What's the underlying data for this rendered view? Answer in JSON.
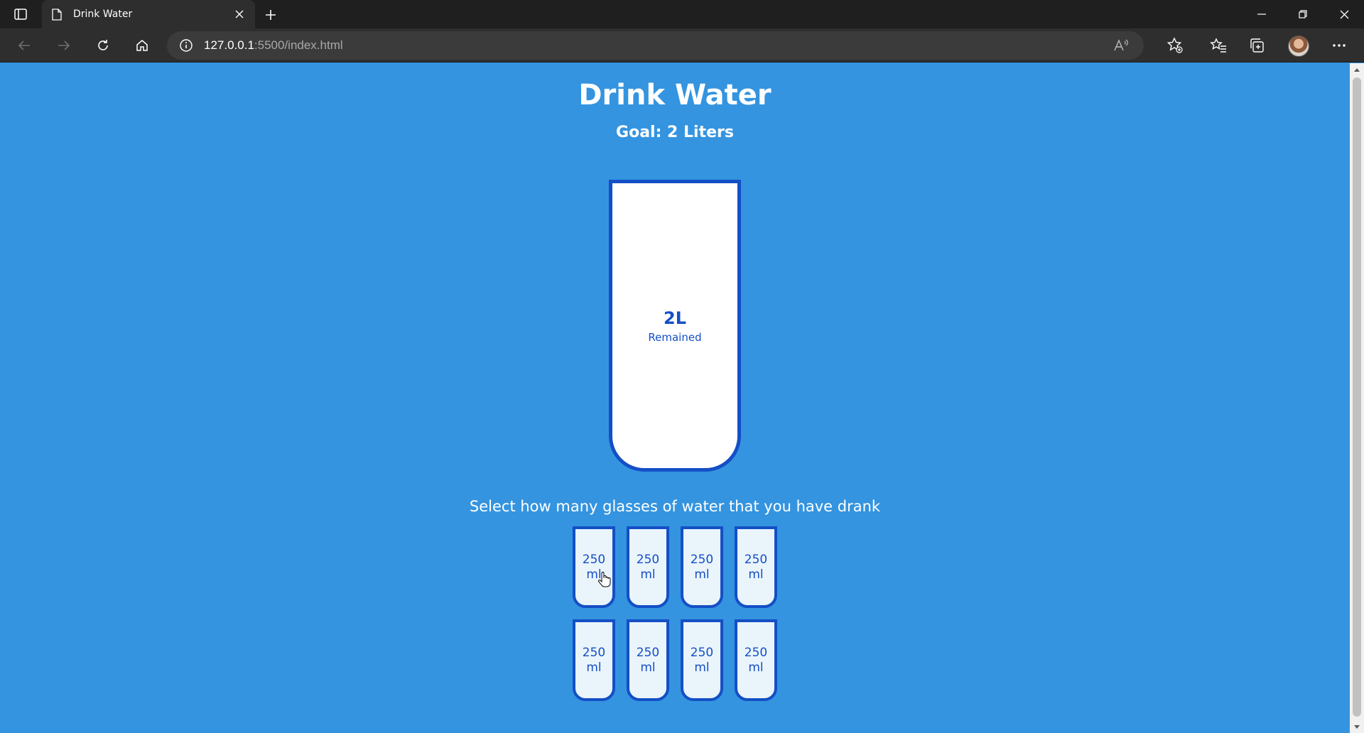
{
  "browser": {
    "tab_title": "Drink Water",
    "url_host": "127.0.0.1",
    "url_rest": ":5500/index.html"
  },
  "page": {
    "title": "Drink Water",
    "goal": "Goal: 2 Liters",
    "remained_amount": "2L",
    "remained_label": "Remained",
    "instruction": "Select how many glasses of water that you have drank",
    "cups": [
      {
        "label": "250 ml"
      },
      {
        "label": "250 ml"
      },
      {
        "label": "250 ml"
      },
      {
        "label": "250 ml"
      },
      {
        "label": "250 ml"
      },
      {
        "label": "250 ml"
      },
      {
        "label": "250 ml"
      },
      {
        "label": "250 ml"
      }
    ]
  },
  "colors": {
    "background": "#3494e0",
    "cup_border": "#144fc6",
    "cup_fill": "#ffffff"
  }
}
